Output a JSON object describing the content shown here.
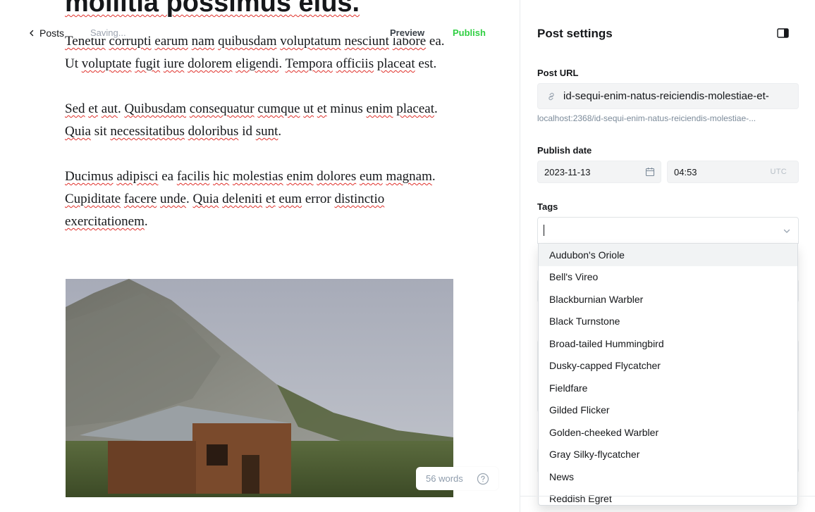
{
  "editor": {
    "title": "mollitia possimus eius.",
    "back_label": "Posts",
    "status": "Saving...",
    "preview_label": "Preview",
    "publish_label": "Publish",
    "word_count": "56 words",
    "paragraphs": [
      "Tenetur corrupti earum nam quibusdam voluptatum nesciunt labore ea. Ut voluptate fugit iure dolorem eligendi. Tempora officiis placeat est.",
      "Sed et aut. Quibusdam consequatur cumque ut et minus enim placeat. Quia sit necessitatibus doloribus id sunt.",
      "Ducimus adipisci ea facilis hic molestias enim dolores eum magnam. Cupiditate facere unde. Quia deleniti et eum error distinctio exercitationem."
    ]
  },
  "settings": {
    "title": "Post settings",
    "post_url_label": "Post URL",
    "post_url_value": "id-sequi-enim-natus-reiciendis-molestiae-et-",
    "post_url_hint": "localhost:2368/id-sequi-enim-natus-reiciendis-molestiae-...",
    "publish_date_label": "Publish date",
    "date_value": "2023-11-13",
    "time_value": "04:53",
    "timezone": "UTC",
    "tags_label": "Tags",
    "tag_options": [
      "Audubon's Oriole",
      "Bell's Vireo",
      "Blackburnian Warbler",
      "Black Turnstone",
      "Broad-tailed Hummingbird",
      "Dusky-capped Flycatcher",
      "Fieldfare",
      "Gilded Flicker",
      "Golden-cheeked Warbler",
      "Gray Silky-flycatcher",
      "News",
      "Reddish Egret"
    ]
  },
  "colors": {
    "publish": "#30cf43",
    "spellcheck": "#e0302a"
  }
}
